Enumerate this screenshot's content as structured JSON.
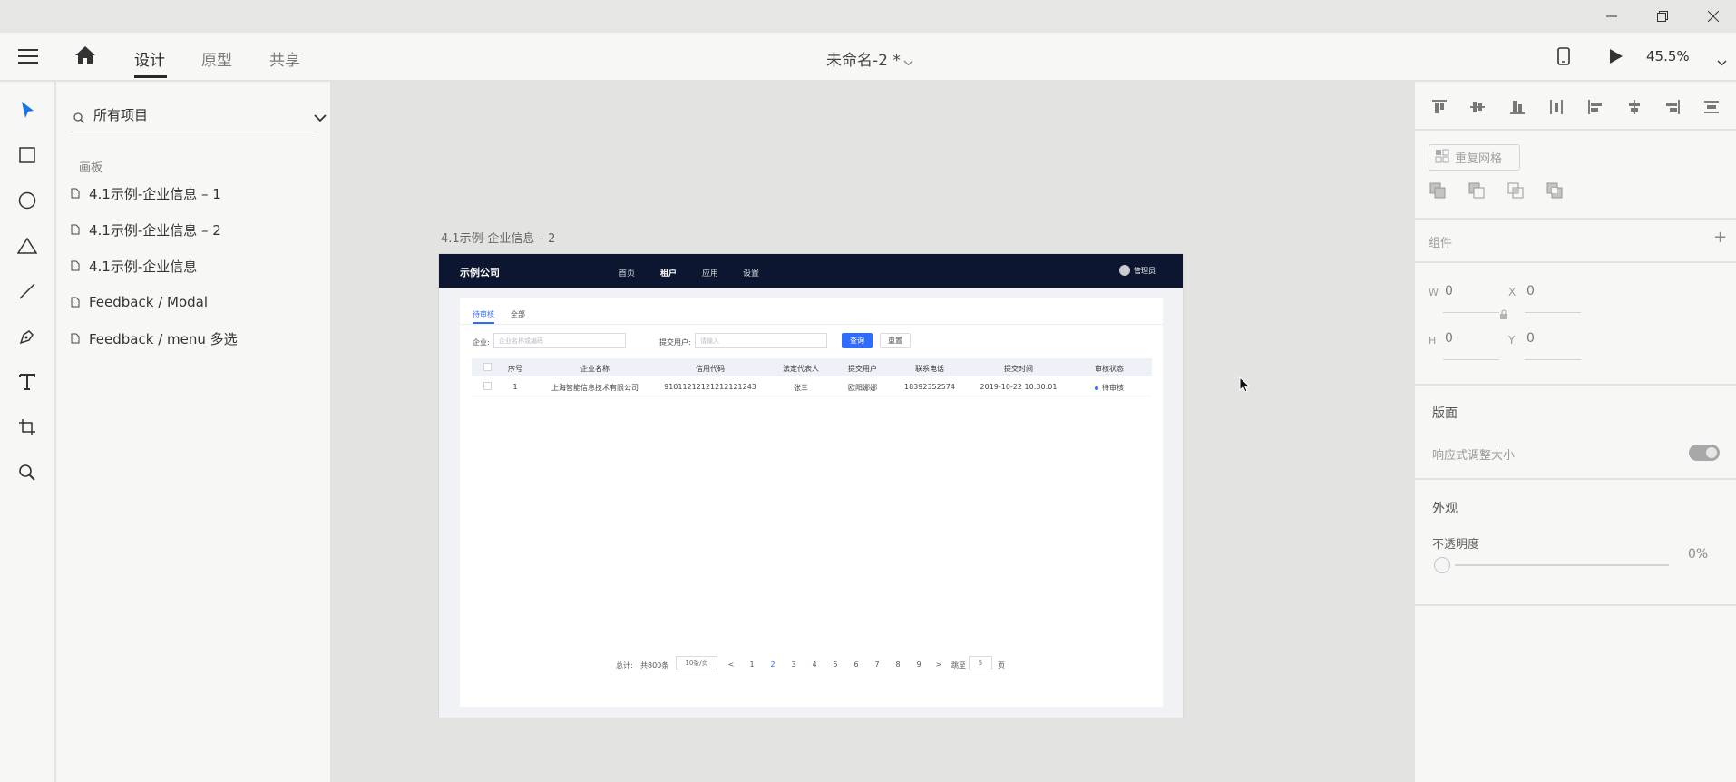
{
  "window": {
    "minimize_icon": "minimize-icon",
    "restore_icon": "restore-icon",
    "close_icon": "close-icon"
  },
  "appbar": {
    "tabs": [
      "设计",
      "原型",
      "共享"
    ],
    "active_tab": "设计",
    "document_title": "未命名-2 *",
    "zoom": "45.5%"
  },
  "tools": [
    "select-tool",
    "rectangle-tool",
    "ellipse-tool",
    "triangle-tool",
    "line-tool",
    "pen-tool",
    "text-tool",
    "artboard-tool",
    "zoom-tool"
  ],
  "layers": {
    "search_label": "所有项目",
    "section_title": "画板",
    "items": [
      "4.1示例-企业信息 – 1",
      "4.1示例-企业信息 – 2",
      "4.1示例-企业信息",
      "Feedback / Modal",
      "Feedback / menu 多选"
    ]
  },
  "canvas": {
    "artboard_label": "4.1示例-企业信息 – 2",
    "artboard": {
      "logo": "示例公司",
      "nav": [
        "首页",
        "租户",
        "应用",
        "设置"
      ],
      "active_nav": "租户",
      "user": "管理员",
      "tabs": [
        "待审核",
        "全部"
      ],
      "filter_company_label": "企业:",
      "filter_company_placeholder": "企业名称或编码",
      "filter_user_label": "提交用户:",
      "filter_user_placeholder": "请输入",
      "query_button": "查询",
      "reset_button": "重置",
      "columns": [
        "序号",
        "企业名称",
        "信用代码",
        "法定代表人",
        "提交用户",
        "联系电话",
        "提交时间",
        "审核状态"
      ],
      "rows": [
        [
          "1",
          "上海智能信息技术有限公司",
          "91011212121212121243",
          "张三",
          "欧阳娜娜",
          "18392352574",
          "2019-10-22 10:30:01",
          "待审核"
        ]
      ],
      "pager": {
        "total_label": "总计:",
        "total_value": "共800条",
        "page_size": "10条/页",
        "prev": "<",
        "pages": [
          "1",
          "2",
          "3",
          "4",
          "5",
          "6",
          "7",
          "8",
          "9"
        ],
        "current_page": "2",
        "next": ">",
        "jump_label": "跳至",
        "jump_value": "5",
        "page_unit": "页"
      }
    }
  },
  "inspector": {
    "repeat_grid": "重复网格",
    "component_label": "组件",
    "add_icon": "plus-icon",
    "w_label": "W",
    "w_value": "0",
    "x_label": "X",
    "x_value": "0",
    "h_label": "H",
    "h_value": "0",
    "y_label": "Y",
    "y_value": "0",
    "layout_heading": "版面",
    "responsive_label": "响应式调整大小",
    "responsive_on": true,
    "appearance_heading": "外观",
    "opacity_label": "不透明度",
    "opacity_value": "0%"
  },
  "colors": {
    "accent": "#2f6bff",
    "artboard_header": "#0d1630",
    "chrome": "#f7f7f5"
  }
}
